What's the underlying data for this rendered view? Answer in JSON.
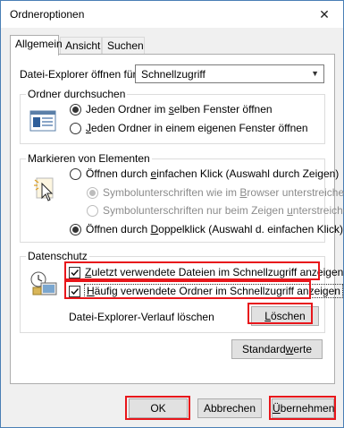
{
  "window": {
    "title": "Ordneroptionen",
    "close_glyph": "✕"
  },
  "tabs": [
    {
      "label": "Allgemein",
      "active": true
    },
    {
      "label": "Ansicht",
      "active": false
    },
    {
      "label": "Suchen",
      "active": false
    }
  ],
  "explorer_open": {
    "label": "Datei-Explorer öffnen für:",
    "value": "Schnellzugriff"
  },
  "browse_group": {
    "title": "Ordner durchsuchen",
    "icon": "folder-window-icon",
    "option1": "Jeden Ordner im selben Fenster öffnen",
    "option2": "Jeden Ordner in einem eigenen Fenster öffnen",
    "selected": 1
  },
  "click_group": {
    "title": "Markieren von Elementen",
    "icon": "pointer-click-icon",
    "single": "Öffnen durch einfachen Klick (Auswahl durch Zeigen)",
    "sub1": "Symbolunterschriften wie im Browser unterstreichen",
    "sub2": "Symbolunterschriften nur beim Zeigen unterstreichen",
    "double": "Öffnen durch Doppelklick (Auswahl d. einfachen Klick)",
    "selected": "double"
  },
  "privacy_group": {
    "title": "Datenschutz",
    "icon": "privacy-clock-icon",
    "recent_files": "Zuletzt verwendete Dateien im Schnellzugriff anzeigen",
    "frequent_folders": "Häufig verwendete Ordner im Schnellzugriff anzeigen",
    "recent_checked": true,
    "frequent_checked": true,
    "clear_label": "Datei-Explorer-Verlauf löschen",
    "clear_button": "Löschen"
  },
  "restore_button": "Standardwerte",
  "footer": {
    "ok": "OK",
    "cancel": "Abbrechen",
    "apply": "Übernehmen"
  },
  "colors": {
    "highlight": "#e8161b",
    "border": "#adadad"
  }
}
